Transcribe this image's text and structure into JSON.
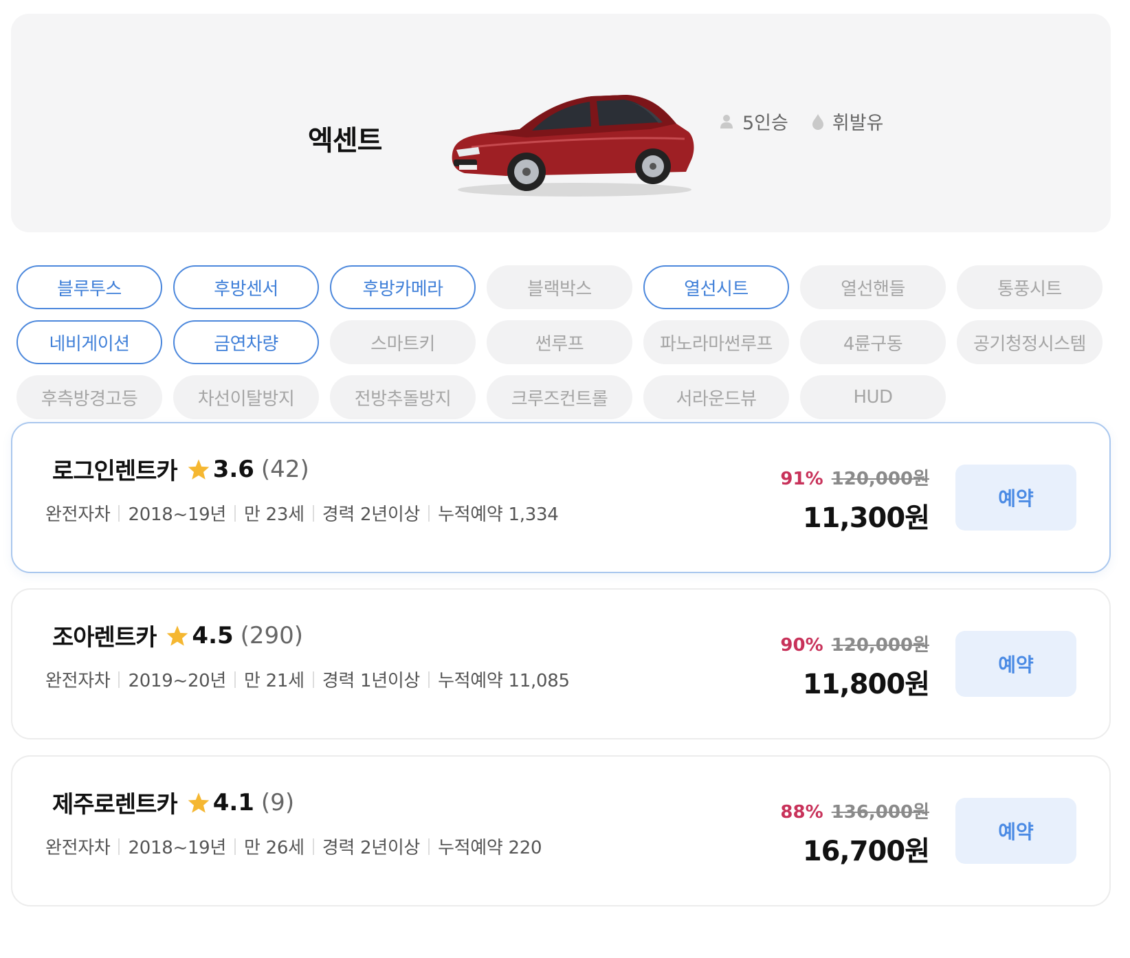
{
  "car": {
    "name": "엑센트",
    "seats": "5인승",
    "fuel": "휘발유"
  },
  "options": [
    {
      "label": "블루투스",
      "active": true
    },
    {
      "label": "후방센서",
      "active": true
    },
    {
      "label": "후방카메라",
      "active": true
    },
    {
      "label": "블랙박스",
      "active": false
    },
    {
      "label": "열선시트",
      "active": true
    },
    {
      "label": "열선핸들",
      "active": false
    },
    {
      "label": "통풍시트",
      "active": false
    },
    {
      "label": "네비게이션",
      "active": true
    },
    {
      "label": "금연차량",
      "active": true
    },
    {
      "label": "스마트키",
      "active": false
    },
    {
      "label": "썬루프",
      "active": false
    },
    {
      "label": "파노라마썬루프",
      "active": false
    },
    {
      "label": "4륜구동",
      "active": false
    },
    {
      "label": "공기청정시스템",
      "active": false
    },
    {
      "label": "후측방경고등",
      "active": false
    },
    {
      "label": "차선이탈방지",
      "active": false
    },
    {
      "label": "전방추돌방지",
      "active": false
    },
    {
      "label": "크루즈컨트롤",
      "active": false
    },
    {
      "label": "서라운드뷰",
      "active": false
    },
    {
      "label": "HUD",
      "active": false
    }
  ],
  "offers": [
    {
      "vendor": "로그인렌트카",
      "rating": "3.6",
      "reviews": "(42)",
      "insurance": "완전자차",
      "model_year": "2018~19년",
      "min_age": "만 23세",
      "experience": "경력 2년이상",
      "bookings": "누적예약 1,334",
      "discount": "91%",
      "original_price": "120,000원",
      "price": "11,300원",
      "button": "예약",
      "selected": true
    },
    {
      "vendor": "조아렌트카",
      "rating": "4.5",
      "reviews": "(290)",
      "insurance": "완전자차",
      "model_year": "2019~20년",
      "min_age": "만 21세",
      "experience": "경력 1년이상",
      "bookings": "누적예약 11,085",
      "discount": "90%",
      "original_price": "120,000원",
      "price": "11,800원",
      "button": "예약",
      "selected": false
    },
    {
      "vendor": "제주로렌트카",
      "rating": "4.1",
      "reviews": "(9)",
      "insurance": "완전자차",
      "model_year": "2018~19년",
      "min_age": "만 26세",
      "experience": "경력 2년이상",
      "bookings": "누적예약 220",
      "discount": "88%",
      "original_price": "136,000원",
      "price": "16,700원",
      "button": "예약",
      "selected": false
    }
  ],
  "colors": {
    "accent": "#4b87dc",
    "discount": "#c8325a",
    "button_bg": "#e8f0fc",
    "star": "#f5b731",
    "car_body": "#9e1f24"
  },
  "icons": {
    "seats": "person-icon",
    "fuel": "fuel-drop-icon",
    "rating": "star-icon"
  }
}
